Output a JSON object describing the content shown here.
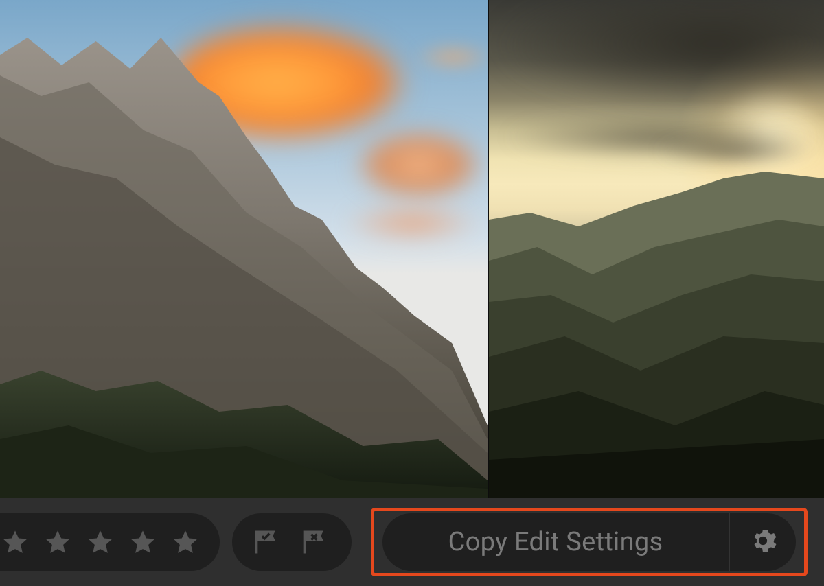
{
  "viewer": {
    "photos": [
      {
        "name": "mountain-sunset-clouds"
      },
      {
        "name": "rolling-hills-sunset"
      }
    ]
  },
  "toolbar": {
    "star_rating": {
      "max": 5,
      "value": 0
    },
    "flags": {
      "pick_label": "pick-flag",
      "reject_label": "reject-flag"
    },
    "copy_button_label": "Copy Edit Settings",
    "settings_icon": "gear-icon"
  },
  "colors": {
    "highlight_border": "#e5481d",
    "panel_bg": "#2f2f2f",
    "well_bg": "#1f1f1f",
    "inactive_icon": "#565656",
    "text_muted": "#7a7a7a"
  }
}
